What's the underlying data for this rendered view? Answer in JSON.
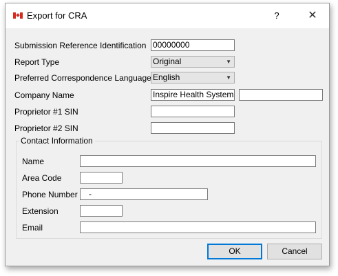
{
  "window": {
    "title": "Export for CRA",
    "help_label": "?",
    "close_label": "✕",
    "flag_icon": "canada-flag-icon"
  },
  "form": {
    "submission_ref_label": "Submission Reference Identification",
    "submission_ref_value": "00000000",
    "report_type_label": "Report Type",
    "report_type_value": "Original",
    "language_label": "Preferred Correspondence Language",
    "language_value": "English",
    "company_name_label": "Company Name",
    "company_name_value": "Inspire Health Systems",
    "company_name_value2": "",
    "proprietor1_label": "Proprietor #1 SIN",
    "proprietor1_value": "",
    "proprietor2_label": "Proprietor #2 SIN",
    "proprietor2_value": ""
  },
  "contact": {
    "group_title": "Contact Information",
    "name_label": "Name",
    "name_value": "",
    "area_code_label": "Area Code",
    "area_code_value": "",
    "phone_label": "Phone Number",
    "phone_value": "   -",
    "extension_label": "Extension",
    "extension_value": "",
    "email_label": "Email",
    "email_value": ""
  },
  "buttons": {
    "ok_label": "OK",
    "cancel_label": "Cancel"
  },
  "colors": {
    "flag_red": "#d52b1e",
    "default_button_border": "#0078d7",
    "dialog_background": "#f0f0f0"
  }
}
